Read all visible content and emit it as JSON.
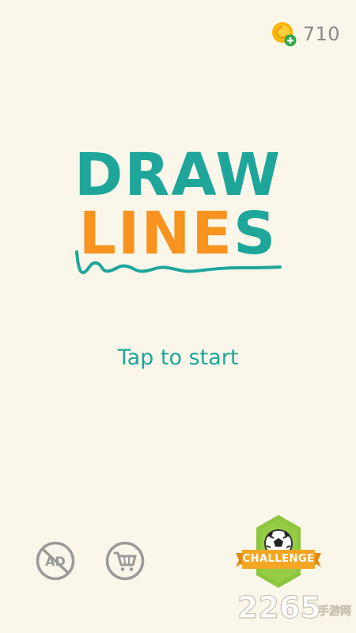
{
  "hud": {
    "coin_count": "710"
  },
  "logo": {
    "line1": "DRAW",
    "line2_orange": "LINE",
    "line2_teal": "S"
  },
  "prompt": {
    "tap_to_start": "Tap to start"
  },
  "buttons": {
    "no_ads_icon_text": "AD",
    "challenge_label": "CHALLENGE"
  },
  "watermark": {
    "text": "2265",
    "suffix": "手游网"
  },
  "colors": {
    "background": "#fbf6ea",
    "teal": "#1fa69a",
    "orange": "#f7931e",
    "gray": "#8a8a8a",
    "challenge_green": "#8cc63f",
    "ribbon_orange": "#f5a623"
  }
}
